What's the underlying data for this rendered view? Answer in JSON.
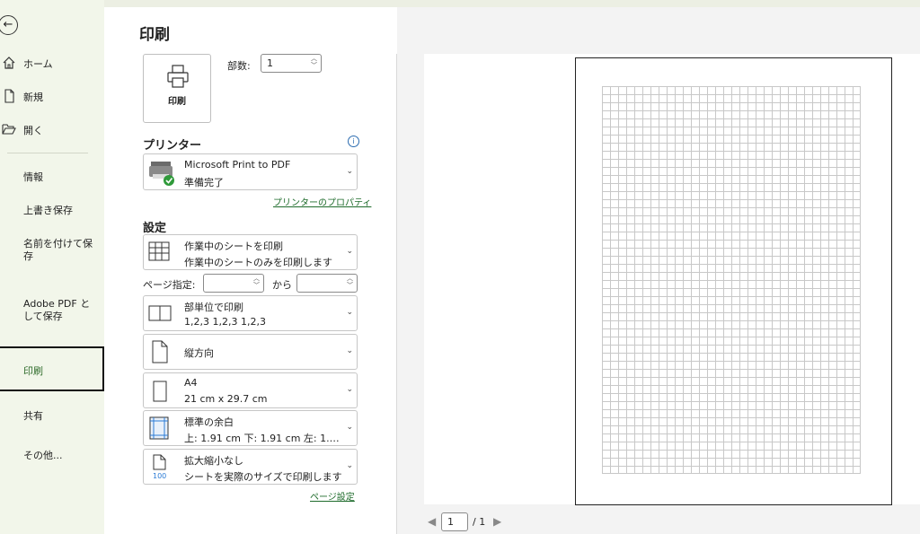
{
  "sidebar": {
    "items": [
      {
        "label": "ホーム"
      },
      {
        "label": "新規"
      },
      {
        "label": "開く"
      },
      {
        "label": "情報"
      },
      {
        "label": "上書き保存"
      },
      {
        "label": "名前を付けて保存"
      },
      {
        "label": "Adobe PDF として保存"
      },
      {
        "label": "印刷"
      },
      {
        "label": "共有"
      },
      {
        "label": "その他..."
      }
    ]
  },
  "main": {
    "title": "印刷",
    "print_button_label": "印刷",
    "copies_label": "部数:",
    "copies_value": "1",
    "printer_heading": "プリンター",
    "printer_name": "Microsoft Print to PDF",
    "printer_status": "準備完了",
    "printer_properties_link": "プリンターのプロパティ",
    "settings_heading": "設定",
    "settings": [
      {
        "line1": "作業中のシートを印刷",
        "line2": "作業中のシートのみを印刷します"
      },
      {
        "line1": "部単位で印刷",
        "line2": "1,2,3    1,2,3    1,2,3"
      },
      {
        "line1": "縦方向",
        "line2": ""
      },
      {
        "line1": "A4",
        "line2": "21 cm x 29.7 cm"
      },
      {
        "line1": "標準の余白",
        "line2": "上: 1.91 cm 下: 1.91 cm 左: 1.…"
      },
      {
        "line1": "拡大縮小なし",
        "line2": "シートを実際のサイズで印刷します"
      }
    ],
    "pages_label": "ページ指定:",
    "pages_to_label": "から",
    "page_setup_link": "ページ設定",
    "scale_icon_text": "100"
  },
  "preview": {
    "current_page": "1",
    "total_pages": "/ 1"
  },
  "colors": {
    "accent": "#2e6b2a",
    "sidebar_bg": "#f2f6ea"
  }
}
